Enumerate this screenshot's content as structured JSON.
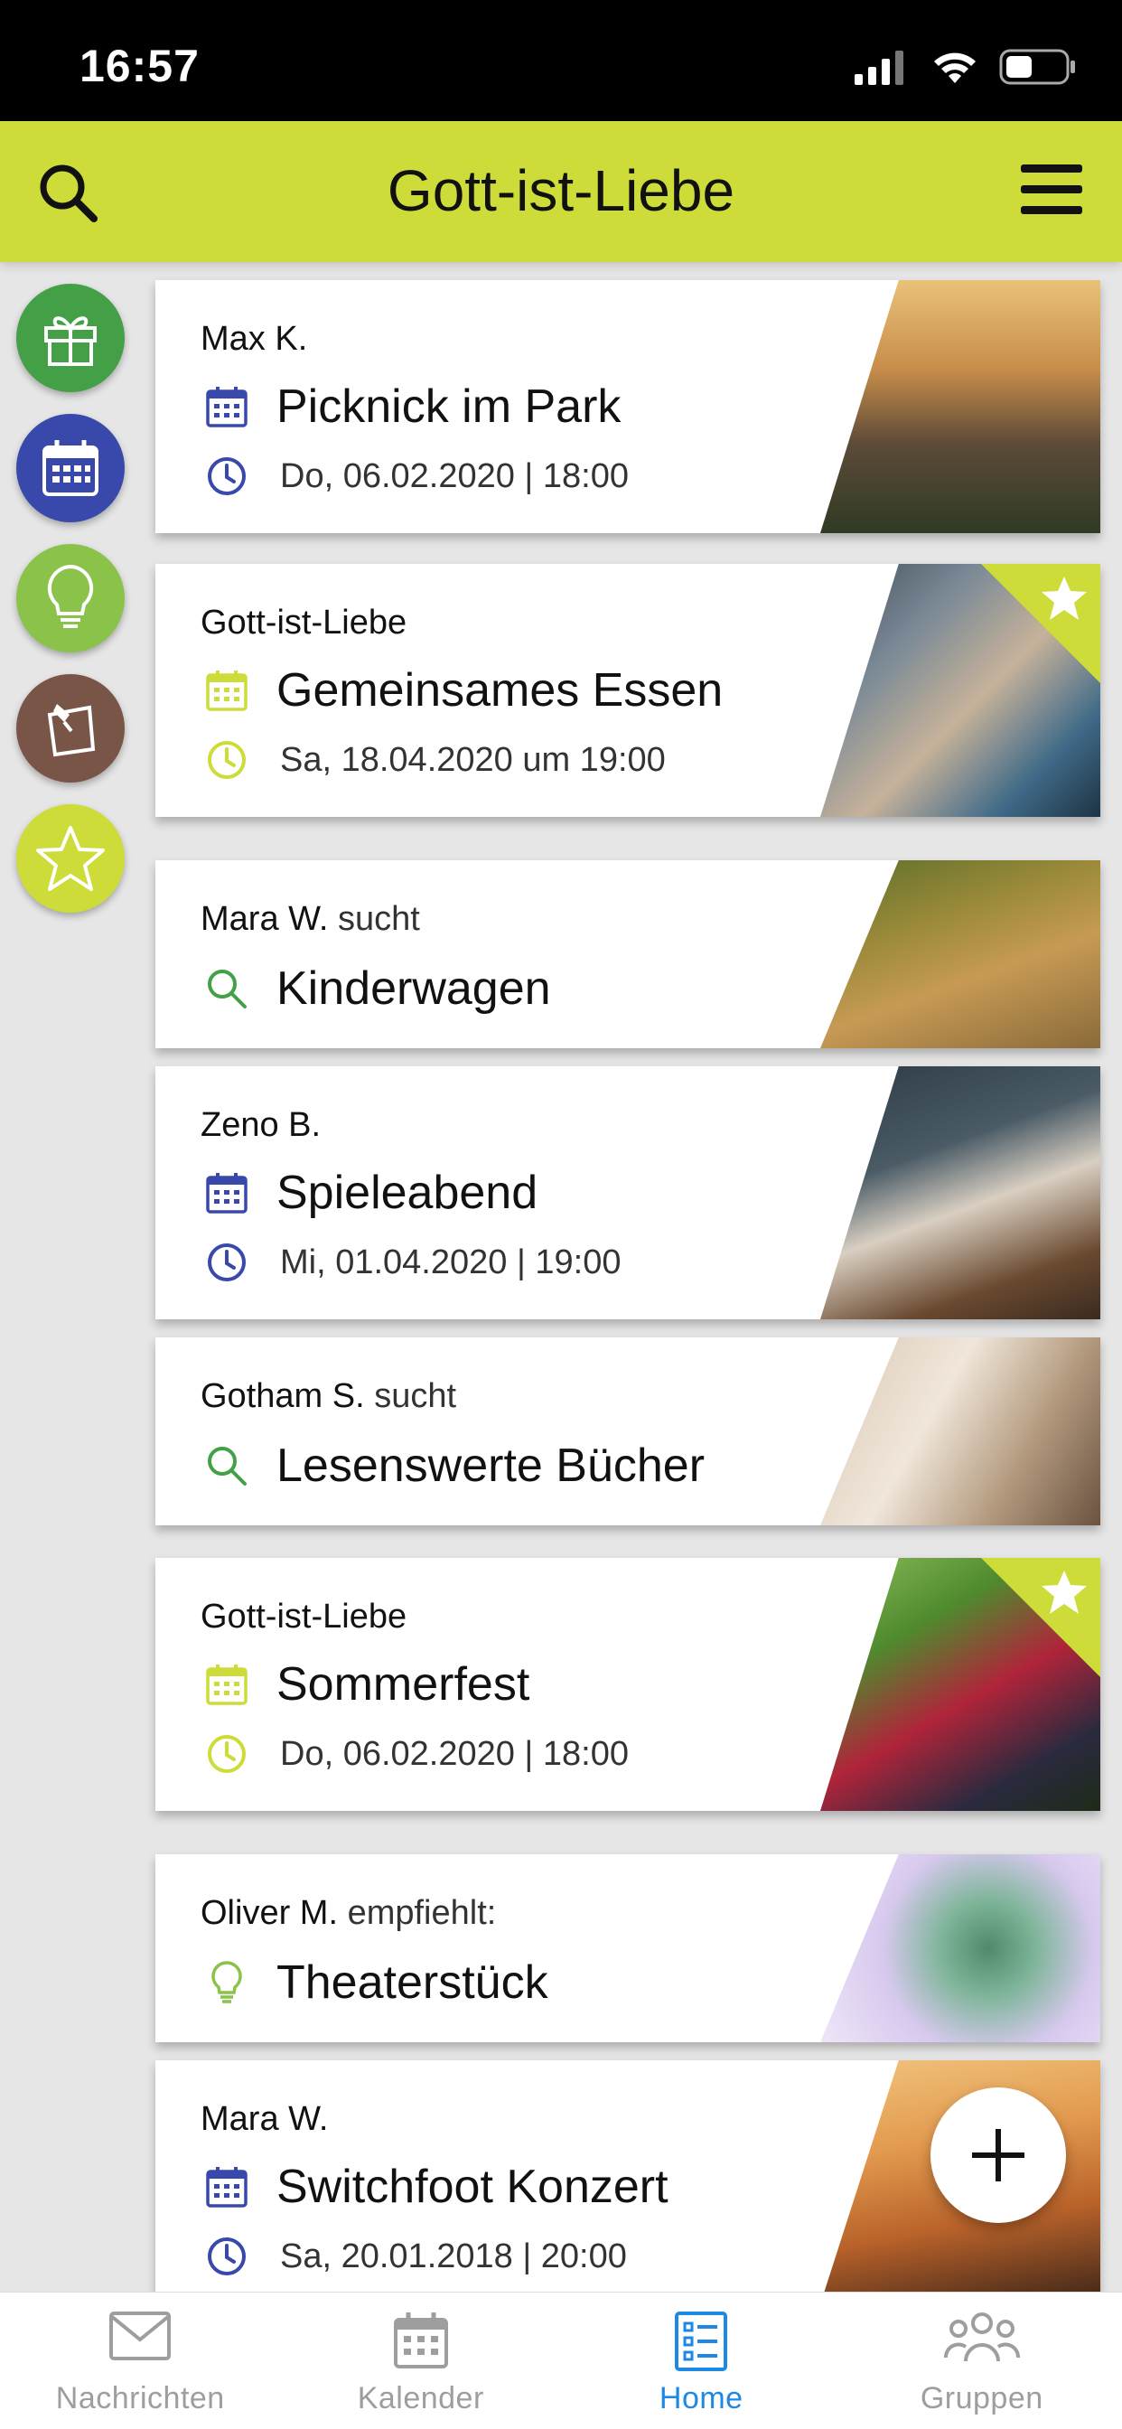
{
  "status_bar": {
    "time": "16:57"
  },
  "header": {
    "title": "Gott-ist-Liebe"
  },
  "side_actions": [
    {
      "name": "gift-icon",
      "color": "#43a047"
    },
    {
      "name": "calendar-icon",
      "color": "#3949ab"
    },
    {
      "name": "lightbulb-icon",
      "color": "#8bc34a"
    },
    {
      "name": "note-pin-icon",
      "color": "#795548"
    },
    {
      "name": "star-icon",
      "color": "#cddc39"
    }
  ],
  "feed": [
    {
      "author": "Max K.",
      "verb": "",
      "title": "Picknick im Park",
      "date": "Do, 06.02.2020 | 18:00",
      "type": "event",
      "accent": "#3949ab",
      "favorite": false
    },
    {
      "author": "Gott-ist-Liebe",
      "verb": "",
      "title": "Gemeinsames Essen",
      "date": "Sa, 18.04.2020 um 19:00",
      "type": "event",
      "accent": "#cddc39",
      "favorite": true
    },
    {
      "author": "Mara W.",
      "verb": "sucht",
      "title": "Kinderwagen",
      "type": "search",
      "accent": "#43a047",
      "favorite": false
    },
    {
      "author": "Zeno B.",
      "verb": "",
      "title": "Spieleabend",
      "date": "Mi, 01.04.2020 | 19:00",
      "type": "event",
      "accent": "#3949ab",
      "favorite": false
    },
    {
      "author": "Gotham S.",
      "verb": "sucht",
      "title": "Lesenswerte Bücher",
      "type": "search",
      "accent": "#43a047",
      "favorite": false
    },
    {
      "author": "Gott-ist-Liebe",
      "verb": "",
      "title": "Sommerfest",
      "date": "Do, 06.02.2020 | 18:00",
      "type": "event",
      "accent": "#cddc39",
      "favorite": true
    },
    {
      "author": "Oliver M.",
      "verb": "empfiehlt:",
      "title": "Theaterstück",
      "type": "recommendation",
      "accent": "#8bc34a",
      "favorite": false
    },
    {
      "author": "Mara W.",
      "verb": "",
      "title": "Switchfoot Konzert",
      "date": "Sa, 20.01.2018 | 20:00",
      "type": "event",
      "accent": "#3949ab",
      "favorite": false
    }
  ],
  "bottom_nav": {
    "tabs": [
      {
        "label": "Nachrichten",
        "icon": "mail-icon",
        "active": false
      },
      {
        "label": "Kalender",
        "icon": "calendar-icon",
        "active": false
      },
      {
        "label": "Home",
        "icon": "list-icon",
        "active": true
      },
      {
        "label": "Gruppen",
        "icon": "group-icon",
        "active": false
      }
    ],
    "active_color": "#1e88e5"
  }
}
